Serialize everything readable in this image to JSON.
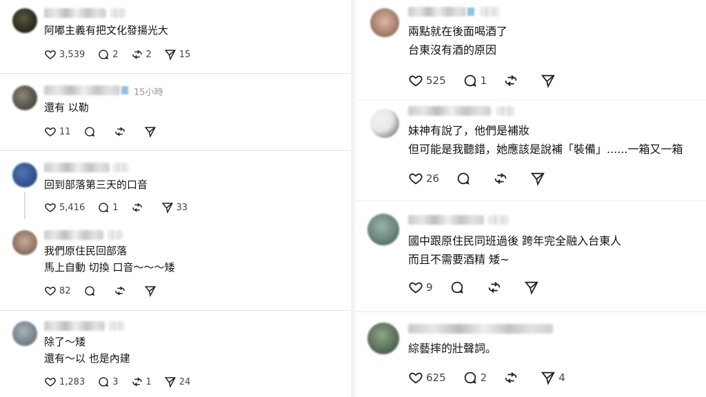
{
  "comments": [
    {
      "id": "c1",
      "lines": [
        "阿嘟主義有把文化發揚光大"
      ],
      "likes": "3,539",
      "replies": "2",
      "reposts": "2",
      "shares": "15"
    },
    {
      "id": "c2",
      "time": "15小時",
      "lines": [
        "還有 以勒"
      ],
      "likes": "11",
      "replies": "",
      "reposts": "",
      "shares": ""
    },
    {
      "id": "c3",
      "lines": [
        "回到部落第三天的口音"
      ],
      "likes": "5,416",
      "replies": "1",
      "reposts": "",
      "shares": "33"
    },
    {
      "id": "c4",
      "lines": [
        "我們原住民回部落",
        "馬上自動 切換 口音～～～矮"
      ],
      "likes": "82",
      "replies": "",
      "reposts": "",
      "shares": ""
    },
    {
      "id": "c5",
      "lines": [
        "除了～矮",
        "還有～以 也是內建"
      ],
      "likes": "1,283",
      "replies": "3",
      "reposts": "1",
      "shares": "24"
    },
    {
      "id": "c6",
      "lines": [
        "兩點就在後面喝酒了",
        "台東沒有酒的原因"
      ],
      "likes": "525",
      "replies": "1",
      "reposts": "",
      "shares": ""
    },
    {
      "id": "c7",
      "lines": [
        "妹神有說了，他們是補妝",
        "但可能是我聽錯，她應該是說補「裝備」......一箱又一箱"
      ],
      "likes": "26",
      "replies": "",
      "reposts": "",
      "shares": ""
    },
    {
      "id": "c8",
      "lines": [
        "國中跟原住民同班過後 跨年完全融入台東人",
        "而且不需要酒精 矮~"
      ],
      "likes": "9",
      "replies": "",
      "reposts": "",
      "shares": ""
    },
    {
      "id": "c9",
      "lines": [
        "綜藝摔的壯聲詞。"
      ],
      "likes": "625",
      "replies": "2",
      "reposts": "",
      "shares": "4"
    }
  ],
  "colors": {
    "text": "#111111",
    "muted": "#9a9a9a",
    "icon": "#222222",
    "divider": "#e4e4e4"
  },
  "icons": [
    "heart-icon",
    "comment-icon",
    "repost-icon",
    "share-icon"
  ]
}
